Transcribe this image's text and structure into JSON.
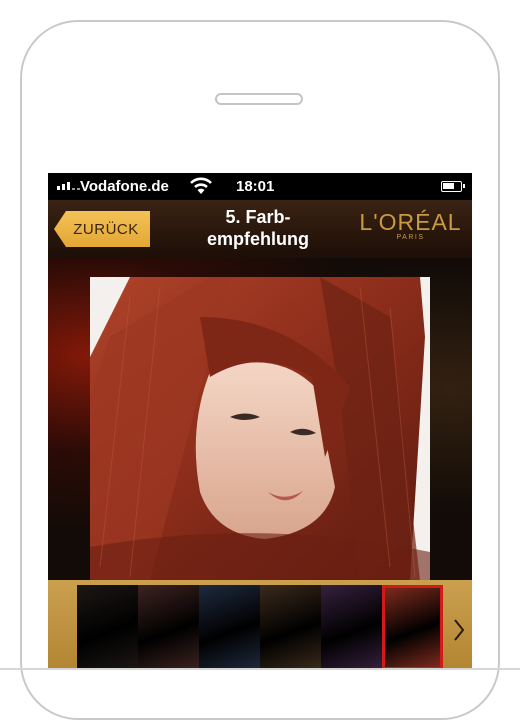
{
  "status_bar": {
    "carrier": "Vodafone.de",
    "time": "18:01"
  },
  "nav": {
    "back_label": "ZURÜCK",
    "title_line1": "5. Farb-",
    "title_line2": "empfehlung"
  },
  "brand": {
    "logo_text": "L'ORÉAL",
    "logo_sub": "PARIS",
    "logo_color": "#c99a3f"
  },
  "swatches": [
    {
      "name": "black",
      "color": "#1c1715"
    },
    {
      "name": "dark-mahogany",
      "color": "#3d2320"
    },
    {
      "name": "blue-black",
      "color": "#1f2a3f"
    },
    {
      "name": "dark-brown",
      "color": "#3b2a1b"
    },
    {
      "name": "violet",
      "color": "#36203e"
    },
    {
      "name": "red-copper",
      "color": "#7d2a1c",
      "selected": true
    }
  ],
  "colors": {
    "accent": "#e8ad3c",
    "selection": "#d21a1a",
    "hair": "#8a2c1a"
  }
}
